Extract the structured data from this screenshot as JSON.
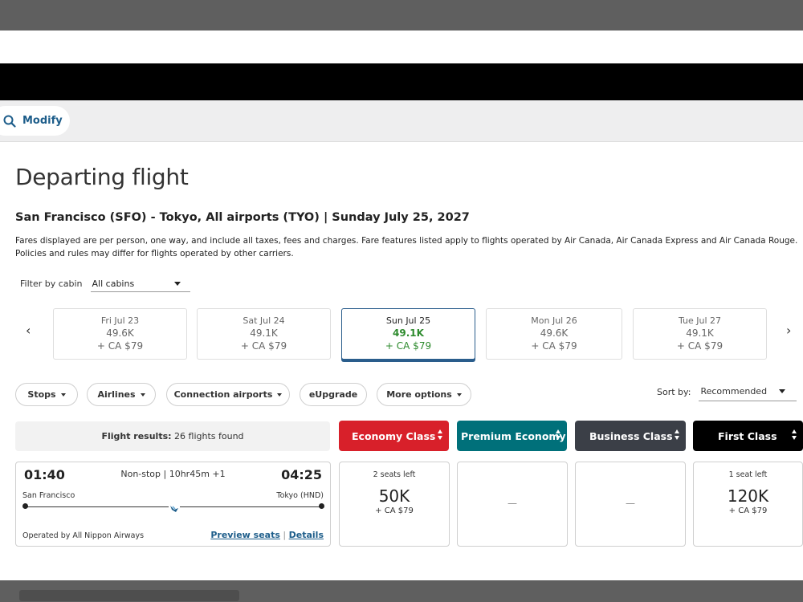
{
  "modify": {
    "label": "Modify"
  },
  "page": {
    "title": "Departing flight",
    "route": "San Francisco (SFO) - Tokyo, All airports (TYO)  |  Sunday July 25, 2027",
    "disclaimer": "Fares displayed are per person, one way, and include all taxes, fees and charges. Fare features listed apply to flights operated by Air Canada, Air Canada Express and Air Canada Rouge. Policies and rules may differ for flights operated by other carriers."
  },
  "cabin_filter": {
    "label": "Filter by cabin",
    "value": "All cabins"
  },
  "dates": [
    {
      "date": "Fri Jul 23",
      "points": "49.6K",
      "fee": "+ CA $79"
    },
    {
      "date": "Sat Jul 24",
      "points": "49.1K",
      "fee": "+ CA $79"
    },
    {
      "date": "Sun Jul 25",
      "points": "49.1K",
      "fee": "+ CA $79"
    },
    {
      "date": "Mon Jul 26",
      "points": "49.6K",
      "fee": "+ CA $79"
    },
    {
      "date": "Tue Jul 27",
      "points": "49.1K",
      "fee": "+ CA $79"
    }
  ],
  "filters": {
    "stops": "Stops",
    "airlines": "Airlines",
    "connection": "Connection airports",
    "eupgrade": "eUpgrade",
    "more": "More options"
  },
  "sort": {
    "label": "Sort by:",
    "value": "Recommended"
  },
  "results": {
    "label": "Flight results:",
    "count": "26 flights found"
  },
  "cabins": [
    {
      "name": "Economy Class",
      "color": "#d8202a"
    },
    {
      "name": "Premium Economy",
      "color": "#00707a"
    },
    {
      "name": "Business Class",
      "color": "#3b3f47"
    },
    {
      "name": "First Class",
      "color": "#000000"
    }
  ],
  "flight": {
    "depart_time": "01:40",
    "arrive_time": "04:25",
    "duration": "Non-stop  |  10hr45m +1",
    "origin": "San Francisco",
    "destination": "Tokyo (HND)",
    "operated_by": "Operated by All Nippon Airways",
    "preview_seats": "Preview seats",
    "separator": "|",
    "details": "Details"
  },
  "fares": {
    "economy": {
      "seats": "2 seats left",
      "points": "50K",
      "fee": "+ CA $79"
    },
    "premium": {
      "dash": "—"
    },
    "business": {
      "dash": "—"
    },
    "first": {
      "seats": "1 seat left",
      "points": "120K",
      "fee": "+ CA $79"
    }
  }
}
